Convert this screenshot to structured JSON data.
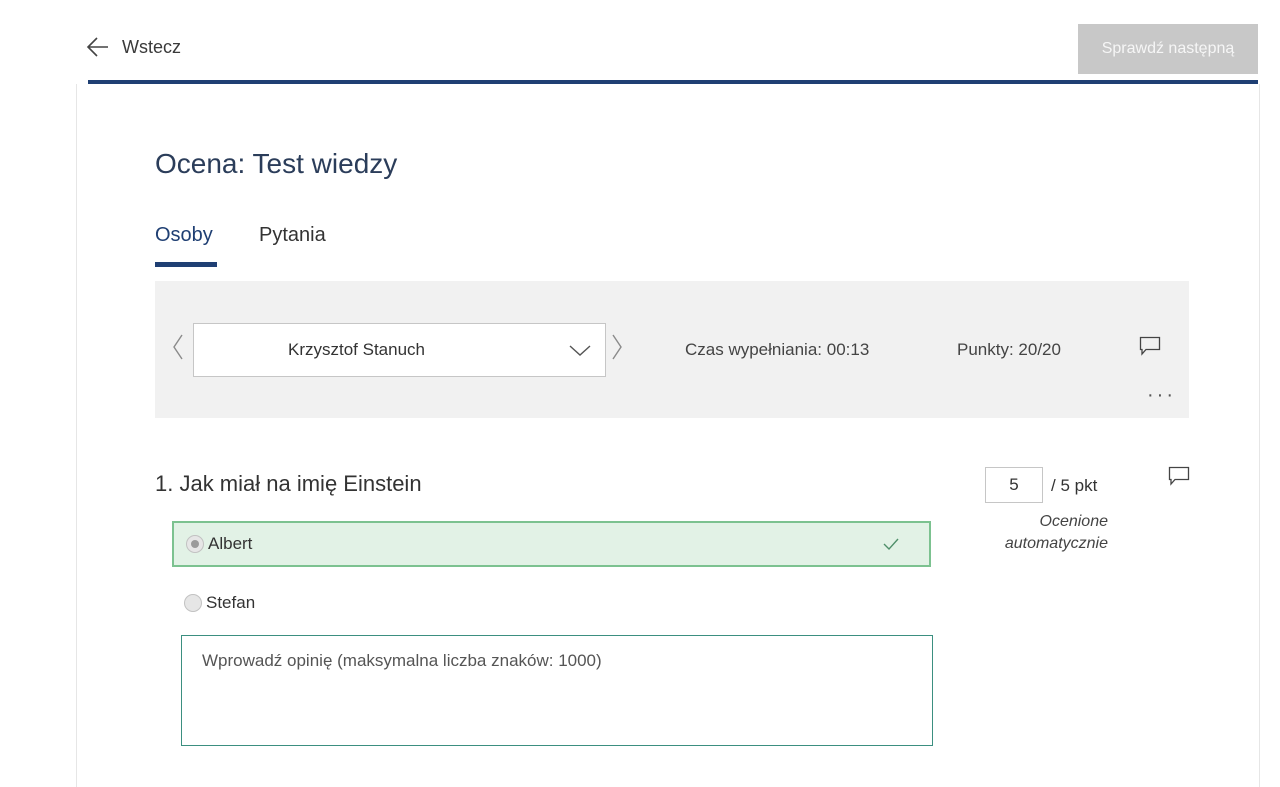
{
  "header": {
    "back_label": "Wstecz",
    "next_button_label": "Sprawdź następną"
  },
  "page": {
    "title": "Ocena: Test wiedzy"
  },
  "tabs": [
    {
      "label": "Osoby",
      "active": true
    },
    {
      "label": "Pytania",
      "active": false
    }
  ],
  "respondent_bar": {
    "selected_respondent": "Krzysztof Stanuch",
    "fill_time": "Czas wypełniania: 00:13",
    "points": "Punkty: 20/20",
    "more_icon": "more-horizontal-icon",
    "comment_icon": "comment-icon"
  },
  "question": {
    "title": "1. Jak miał na imię Einstein",
    "options": [
      {
        "label": "Albert",
        "selected": true,
        "correct": true
      },
      {
        "label": "Stefan",
        "selected": false,
        "correct": false
      }
    ],
    "score_value": "5",
    "score_max": "/ 5 pkt",
    "grading_note": "Ocenione automatycznie",
    "feedback_placeholder": "Wprowadź opinię (maksymalna liczba znaków: 1000)"
  },
  "colors": {
    "accent": "#1f3f73",
    "correct_bg": "#e2f2e6",
    "correct_border": "#7cc290",
    "disabled_button": "#c8c8c8"
  }
}
